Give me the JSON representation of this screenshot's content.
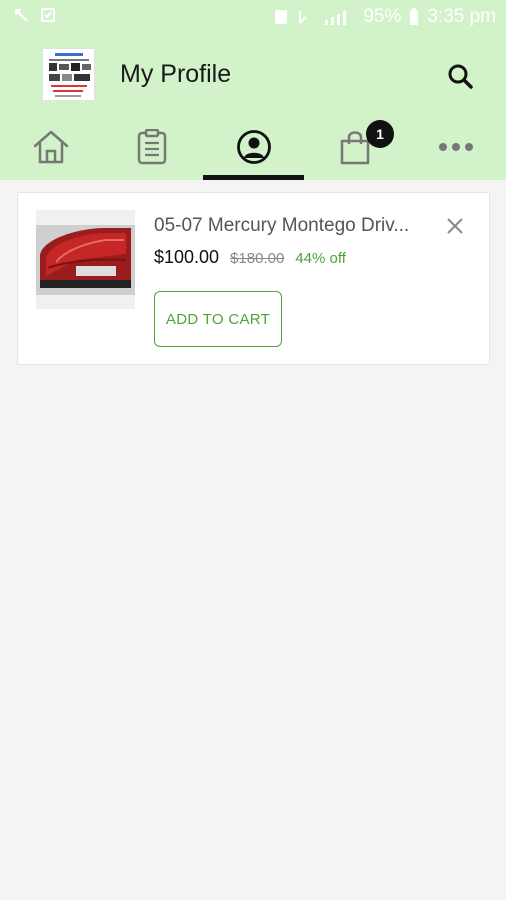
{
  "status_bar": {
    "battery_percent": "95%",
    "time": "3:35 pm",
    "icons": [
      "missed-call-icon",
      "notification-icon",
      "sim-icon",
      "wifi-icon",
      "signal-icon",
      "battery-icon"
    ]
  },
  "header": {
    "title": "My Profile",
    "logo_icon": "store-logo",
    "search_icon": "search-icon"
  },
  "tabs": [
    {
      "name": "home",
      "icon": "home-icon",
      "active": false
    },
    {
      "name": "orders",
      "icon": "clipboard-icon",
      "active": false
    },
    {
      "name": "profile",
      "icon": "user-circle-icon",
      "active": true
    },
    {
      "name": "cart",
      "icon": "shopping-bag-icon",
      "active": false,
      "badge": "1"
    },
    {
      "name": "more",
      "icon": "more-dots-icon",
      "active": false
    }
  ],
  "wishlist": {
    "items": [
      {
        "name": "05-07 Mercury Montego Driv...",
        "price": "$100.00",
        "old_price": "$180.00",
        "discount": "44% off",
        "button_label": "ADD TO CART",
        "image_icon": "tail-light-product-image"
      }
    ]
  },
  "colors": {
    "header_bg": "#d2f2c9",
    "accent_green": "#4fa43a",
    "page_bg": "#f4f4f4",
    "active_indicator": "#111111"
  }
}
